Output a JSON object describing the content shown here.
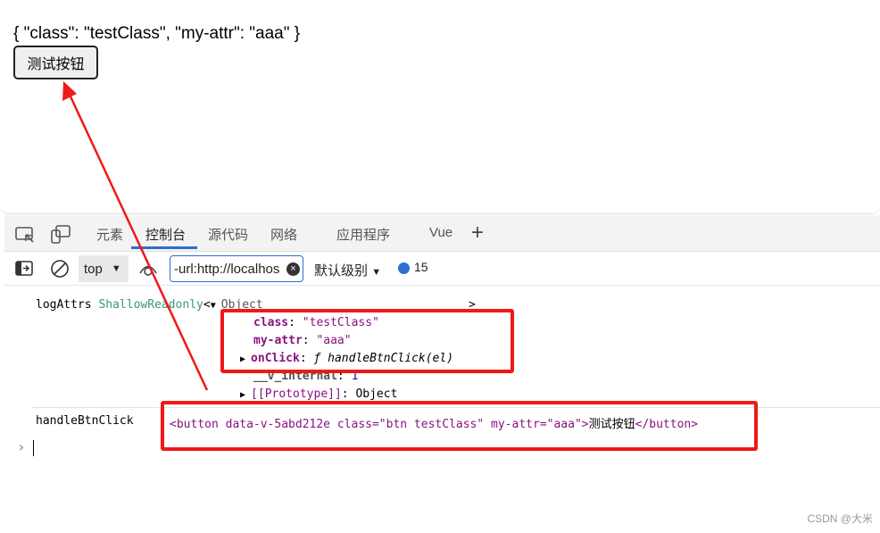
{
  "page": {
    "json_text": "{ \"class\": \"testClass\", \"my-attr\": \"aaa\" }",
    "button_label": "测试按钮"
  },
  "devtools": {
    "tabs": [
      "元素",
      "控制台",
      "源代码",
      "网络",
      "应用程序",
      "Vue"
    ],
    "active_tab": "控制台",
    "toolbar": {
      "context": "top",
      "filter_value": "-url:http://localhos",
      "level": "默认级别",
      "message_count": "15"
    }
  },
  "console": {
    "log1": {
      "label": "logAttrs",
      "type": "ShallowReadonly",
      "lt": "<",
      "obj": "Object",
      "gt": ">",
      "props": [
        {
          "key": "class",
          "value": "\"testClass\""
        },
        {
          "key": "my-attr",
          "value": "\"aaa\""
        },
        {
          "key": "onClick",
          "value": "ƒ handleBtnClick(el)"
        },
        {
          "key": "__v_internal",
          "value": "1"
        },
        {
          "key": "[[Prototype]]",
          "value": "Object"
        }
      ]
    },
    "log2": {
      "label": "handleBtnClick",
      "html_open": "<button data-v-5abd212e class=\"btn testClass\" my-attr=\"aaa\">",
      "html_text": "测试按钮",
      "html_close": "</button>"
    }
  },
  "watermark": "CSDN @大米"
}
